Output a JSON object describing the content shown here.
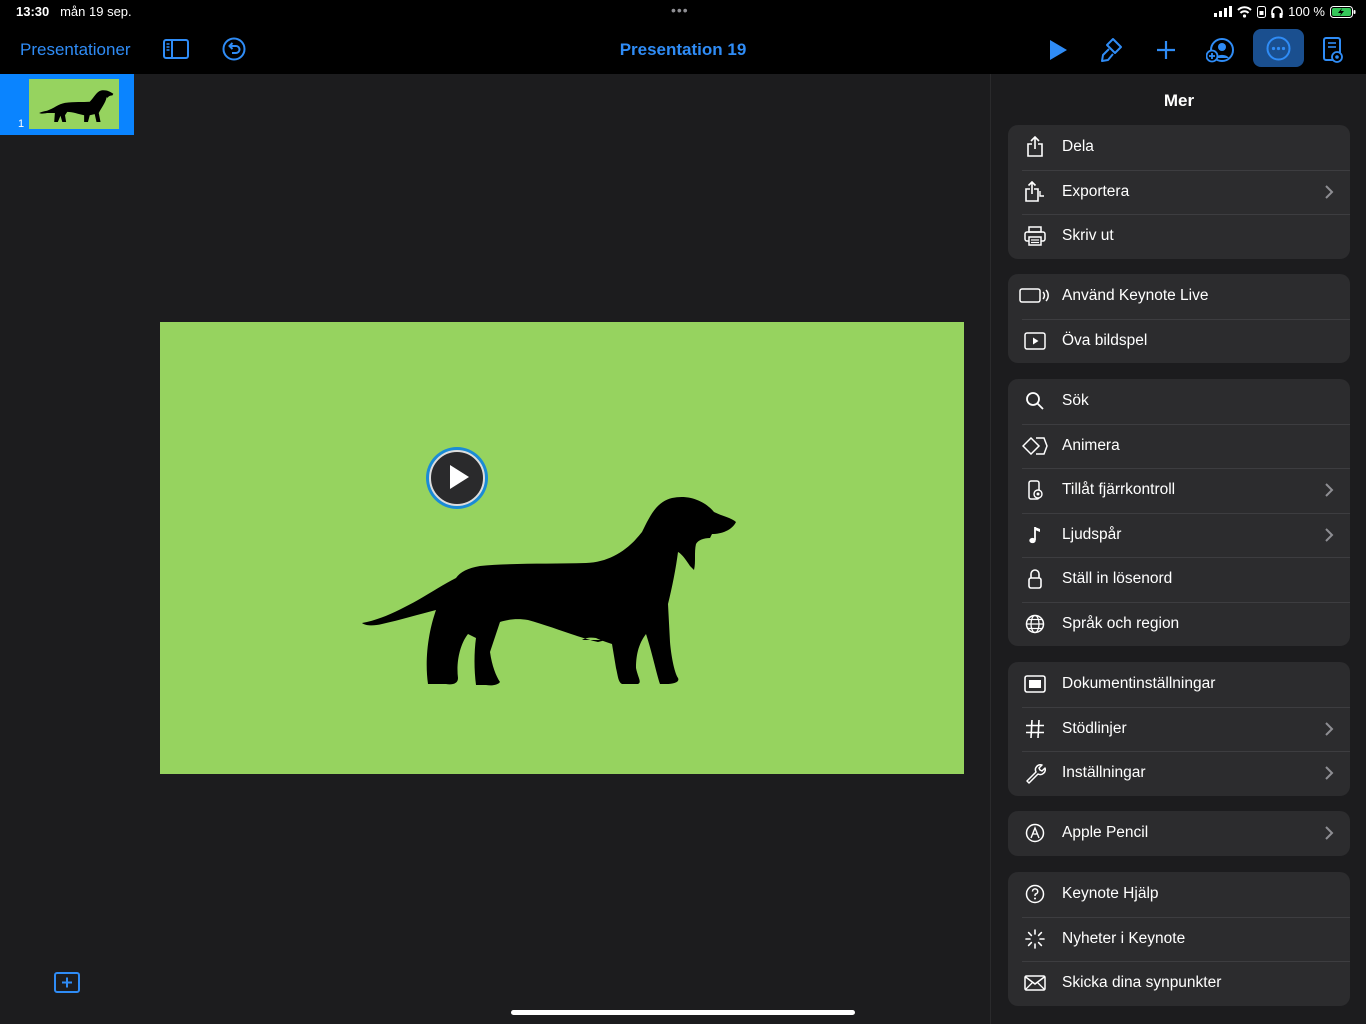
{
  "status": {
    "time": "13:30",
    "date": "mån 19 sep.",
    "battery_text": "100 %"
  },
  "toolbar": {
    "back_label": "Presentationer",
    "title": "Presentation 19",
    "icons": [
      "sidebar-icon",
      "undo-icon",
      "play-icon",
      "brush-icon",
      "plus-icon",
      "collaborate-icon",
      "more-icon",
      "presenter-notes-icon"
    ]
  },
  "sidebar": {
    "slides": [
      {
        "number": "1",
        "selected": true
      }
    ]
  },
  "slide": {
    "background": "#96d35f",
    "object": "dachshund silhouette",
    "video_play_icon": "play-circle-icon"
  },
  "panel": {
    "title": "Mer",
    "groups": [
      {
        "items": [
          {
            "label": "Dela",
            "icon": "share-icon",
            "chevron": false
          },
          {
            "label": "Exportera",
            "icon": "export-icon",
            "chevron": true
          },
          {
            "label": "Skriv ut",
            "icon": "printer-icon",
            "chevron": false
          }
        ]
      },
      {
        "items": [
          {
            "label": "Använd Keynote Live",
            "icon": "keynote-live-icon",
            "chevron": false
          },
          {
            "label": "Öva bildspel",
            "icon": "rehearse-icon",
            "chevron": false
          }
        ]
      },
      {
        "items": [
          {
            "label": "Sök",
            "icon": "search-icon",
            "chevron": false
          },
          {
            "label": "Animera",
            "icon": "animate-icon",
            "chevron": false
          },
          {
            "label": "Tillåt fjärrkontroll",
            "icon": "remote-icon",
            "chevron": true
          },
          {
            "label": "Ljudspår",
            "icon": "music-note-icon",
            "chevron": true
          },
          {
            "label": "Ställ in lösenord",
            "icon": "lock-icon",
            "chevron": false
          },
          {
            "label": "Språk och region",
            "icon": "globe-icon",
            "chevron": false
          }
        ]
      },
      {
        "items": [
          {
            "label": "Dokumentinställningar",
            "icon": "document-setup-icon",
            "chevron": false
          },
          {
            "label": "Stödlinjer",
            "icon": "guides-icon",
            "chevron": true
          },
          {
            "label": "Inställningar",
            "icon": "wrench-icon",
            "chevron": true
          }
        ]
      },
      {
        "items": [
          {
            "label": "Apple Pencil",
            "icon": "pencil-icon",
            "chevron": true
          }
        ]
      },
      {
        "items": [
          {
            "label": "Keynote Hjälp",
            "icon": "help-icon",
            "chevron": false
          },
          {
            "label": "Nyheter i Keynote",
            "icon": "whats-new-icon",
            "chevron": false
          },
          {
            "label": "Skicka dina synpunkter",
            "icon": "mail-icon",
            "chevron": false
          }
        ]
      }
    ]
  },
  "colors": {
    "accent": "#2f8cf6",
    "selection": "#0a84ff",
    "slide_bg": "#96d35f"
  }
}
